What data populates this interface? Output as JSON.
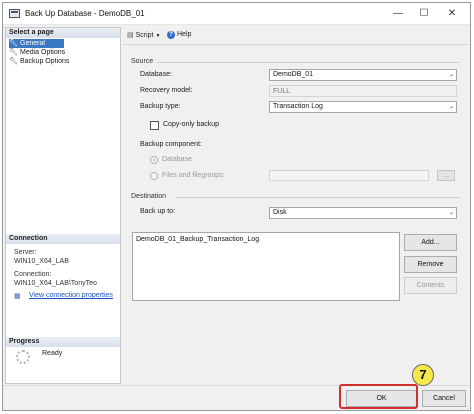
{
  "window": {
    "title": "Back Up Database - DemoDB_01",
    "minimize_glyph": "—",
    "maximize_glyph": "☐",
    "close_glyph": "✕"
  },
  "left": {
    "select_page_header": "Select a page",
    "pages": [
      {
        "label": "General",
        "icon": "wrench-icon",
        "selected": true
      },
      {
        "label": "Media Options",
        "icon": "wrench-icon",
        "selected": false
      },
      {
        "label": "Backup Options",
        "icon": "wrench-icon",
        "selected": false
      }
    ],
    "connection_header": "Connection",
    "server_label": "Server:",
    "server_value": "WIN10_X64_LAB",
    "connection_label": "Connection:",
    "connection_value": "WIN10_X64_LAB\\TonyTeo",
    "view_connection_link": "View connection properties",
    "progress_header": "Progress",
    "progress_status": "Ready"
  },
  "toolbar": {
    "script_label": "Script",
    "help_label": "Help"
  },
  "source": {
    "group_label": "Source",
    "database_label": "Database:",
    "database_value": "DemoDB_01",
    "recovery_label": "Recovery model:",
    "recovery_value": "FULL",
    "backup_type_label": "Backup type:",
    "backup_type_value": "Transaction Log",
    "copy_only_label": "Copy-only backup",
    "copy_only_checked": false,
    "backup_component_label": "Backup component:",
    "component_database_label": "Database",
    "component_files_label": "Files and filegroups:",
    "files_browse_label": "..."
  },
  "destination": {
    "group_label": "Destination",
    "back_up_to_label": "Back up to:",
    "back_up_to_value": "Disk",
    "files": [
      "DemoDB_01_Backup_Transaction_Log"
    ],
    "add_button": "Add...",
    "remove_button": "Remove",
    "contents_button": "Contents"
  },
  "footer": {
    "ok_button": "OK",
    "cancel_button": "Cancel",
    "step_number": "7",
    "highlight_color": "#d22f2f",
    "badge_color": "#f6e84a"
  },
  "colors": {
    "selected_page": "#3a78c4",
    "link": "#1a55c0"
  }
}
